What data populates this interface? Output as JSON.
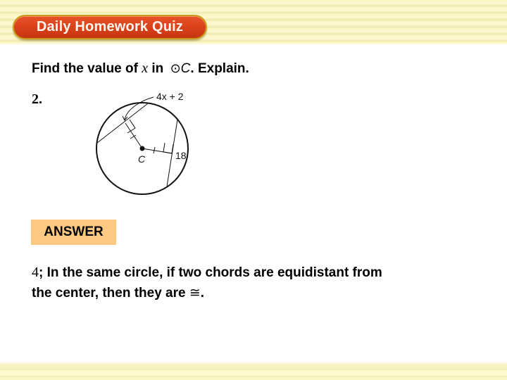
{
  "header": {
    "title": "Daily Homework Quiz",
    "colors": {
      "pill": "#d8401a",
      "pill_border": "#c89a1a",
      "band": "#fbf8c8"
    }
  },
  "question": {
    "prompt_prefix": "Find the value of ",
    "variable": "x",
    "prompt_mid": " in ",
    "circle_symbol": "⊙",
    "circle_name": "C",
    "prompt_suffix": ". Explain.",
    "number": "2."
  },
  "figure": {
    "center_label": "C",
    "chord1_label": "4x + 2",
    "chord2_label": "18"
  },
  "answer": {
    "label": "ANSWER",
    "label_color": "#fdc982",
    "value": "4",
    "explanation_line1": "; In the same circle, if two chords are equidistant from",
    "explanation_line2": "the center, then they are ",
    "congruent_symbol": "≅",
    "end": "."
  }
}
